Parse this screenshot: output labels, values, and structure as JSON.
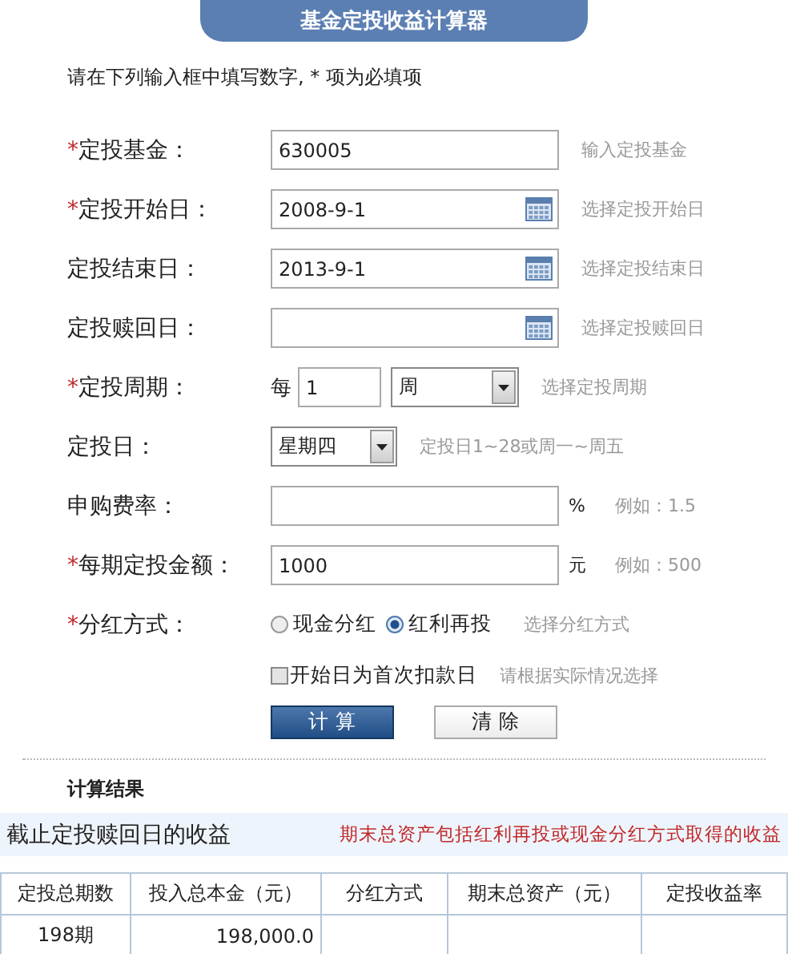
{
  "title": "基金定投收益计算器",
  "instruction": "请在下列输入框中填写数字, *  项为必填项",
  "required_mark": "*",
  "fields": [
    {
      "kind": "text",
      "label": "定投基金：",
      "required": true,
      "value": "630005",
      "hint": "输入定投基金"
    },
    {
      "kind": "date",
      "label": "定投开始日：",
      "required": true,
      "value": "2008-9-1",
      "hint": "选择定投开始日"
    },
    {
      "kind": "date",
      "label": "定投结束日：",
      "required": false,
      "value": "2013-9-1",
      "hint": "选择定投结束日"
    },
    {
      "kind": "date",
      "label": "定投赎回日：",
      "required": false,
      "hint": "选择定投赎回日"
    },
    {
      "kind": "period",
      "label": "定投周期：",
      "required": true,
      "prefix": "每",
      "value": "1",
      "unit": "周",
      "hint": "选择定投周期"
    },
    {
      "kind": "select",
      "label": "定投日：",
      "required": false,
      "value": "星期四",
      "hint": "定投日1~28或周一~周五"
    },
    {
      "kind": "unit",
      "label": "申购费率：",
      "required": false,
      "unit": "%",
      "hint": "例如：1.5"
    },
    {
      "kind": "unit",
      "label": "每期定投金额：",
      "required": true,
      "value": "1000",
      "unit": "元",
      "hint": "例如：500"
    },
    {
      "kind": "radio",
      "label": "分红方式：",
      "required": true,
      "options": [
        {
          "label": "现金分红",
          "selected": false
        },
        {
          "label": "红利再投",
          "selected": true
        }
      ],
      "hint": "选择分红方式"
    }
  ],
  "checkbox": {
    "label": "开始日为首次扣款日",
    "checked": false,
    "hint": "请根据实际情况选择"
  },
  "buttons": [
    {
      "label": "计 算",
      "kind": "primary"
    },
    {
      "label": "清 除",
      "kind": "secondary"
    }
  ],
  "results": {
    "heading": "计算结果",
    "banner_title": "截止定投赎回日的收益",
    "banner_note": "期末总资产包括红利再投或现金分红方式取得的收益",
    "columns": [
      "定投总期数",
      "投入总本金（元）",
      "分红方式",
      "期末总资产（元）",
      "定投收益率"
    ],
    "rows": [
      [
        "198期",
        "198,000.0"
      ]
    ]
  }
}
